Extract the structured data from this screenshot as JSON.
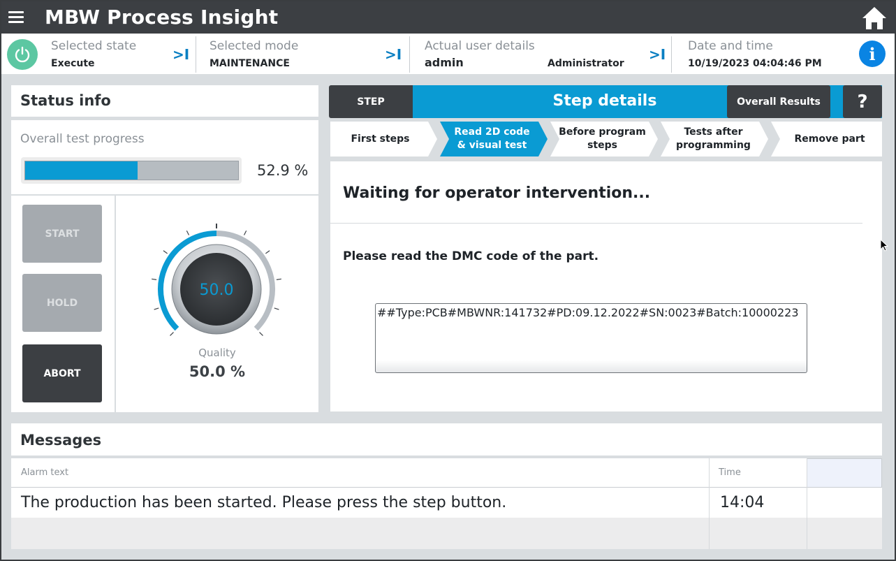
{
  "app": {
    "title": "MBW Process Insight"
  },
  "header": {
    "selected_state": {
      "label": "Selected state",
      "value": "Execute"
    },
    "selected_mode": {
      "label": "Selected mode",
      "value": "MAINTENANCE"
    },
    "user": {
      "label": "Actual user details",
      "name": "admin",
      "role": "Administrator"
    },
    "datetime": {
      "label": "Date and time",
      "value": "10/19/2023 04:04:46 PM"
    },
    "nav_arrow": ">I",
    "info_glyph": "i"
  },
  "status": {
    "title": "Status info",
    "progress_label": "Overall test progress",
    "progress_percent": 52.9,
    "progress_text": "52.9 %",
    "buttons": {
      "start": "START",
      "hold": "HOLD",
      "abort": "ABORT"
    },
    "gauge": {
      "value": 50.0,
      "value_text": "50.0",
      "min": 0,
      "max": 100
    },
    "quality_label": "Quality",
    "quality_text": "50.0 %"
  },
  "step_details": {
    "step_button": "STEP",
    "title": "Step details",
    "overall_results_button": "Overall Results",
    "help_button": "?",
    "steps": [
      {
        "line1": "First steps",
        "line2": ""
      },
      {
        "line1": "Read 2D code",
        "line2": "& visual test"
      },
      {
        "line1": "Before program",
        "line2": "steps"
      },
      {
        "line1": "Tests after",
        "line2": "programming"
      },
      {
        "line1": "Remove part",
        "line2": ""
      }
    ],
    "active_step_index": 1,
    "waiting_text": "Waiting for operator intervention...",
    "instruction": "Please read the DMC code of the part.",
    "dmc_value": "##Type:PCB#MBWNR:141732#PD:09.12.2022#SN:0023#Batch:10000223"
  },
  "messages": {
    "title": "Messages",
    "columns": {
      "alarm_text": "Alarm text",
      "time": "Time"
    },
    "rows": [
      {
        "text": "The production has been started. Please press the step button.",
        "time": "14:04"
      }
    ]
  },
  "colors": {
    "accent": "#0a9bd3",
    "dark": "#3c3f43",
    "power_green": "#5cc7a2",
    "info_blue": "#0a84e3"
  }
}
